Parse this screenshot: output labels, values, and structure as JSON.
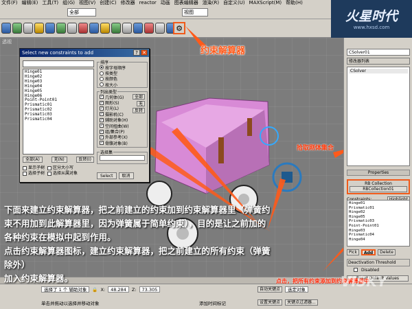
{
  "menubar": [
    "文件(F)",
    "编辑(E)",
    "工具(T)",
    "组(G)",
    "视图(V)",
    "创建(C)",
    "修改器",
    "reactor",
    "动画",
    "图表编辑器",
    "渲染(R)",
    "自定义(U)",
    "MAXScript(M)",
    "帮助(H)"
  ],
  "toolbar": {
    "selection_filter": "全部",
    "coord_system": "视图"
  },
  "logo": {
    "title": "火星时代",
    "url": "www.hxsd.com"
  },
  "viewport": {
    "label": "透视"
  },
  "dialog": {
    "title": "Select new constraints to add",
    "list": [
      "Hinge01",
      "Hinge02",
      "Hinge03",
      "Hinge04",
      "Hinge05",
      "Hinge06",
      "Point-Point01",
      "Prismatic01",
      "Prismatic02",
      "Prismatic03",
      "Prismatic04"
    ],
    "buttons": {
      "all": "全部(A)",
      "none": "无(N)",
      "invert": "反转(I)"
    },
    "options": [
      "显示子树",
      "区分大小写",
      "选择子树",
      "选择从属对象"
    ],
    "sort": {
      "caption": "排序",
      "items": [
        "按字母顺序",
        "按类型",
        "按颜色",
        "按大小"
      ]
    },
    "types": {
      "caption": "列出类型",
      "items": [
        "几何体(G)",
        "图形(S)",
        "灯光(L)",
        "摄影机(C)",
        "辅助对象(H)",
        "空间扭曲(W)",
        "组/集合(P)",
        "外部参考(X)",
        "骨骼对象(B)"
      ],
      "all": "全部",
      "none": "无",
      "invert": "反转"
    },
    "selset": {
      "caption": "选择集"
    },
    "select": "Select",
    "cancel": "取消"
  },
  "right_panel": {
    "name": "CSolver01",
    "modifier_list": "修改器列表",
    "stack_item": "CSolver",
    "rollout": "Properties",
    "rb_collection": "RB Collection",
    "rb_collection_value": "RBCollection01",
    "constraints_label": "Constraints:",
    "highlight": "Highlight",
    "constraints": [
      "Hinge01",
      "Prismatic01",
      "Hinge02",
      "Hinge05",
      "Prismatic03",
      "Point-Point01",
      "Hinge03",
      "Prismatic04",
      "Hinge04"
    ],
    "pick": "Pick",
    "add": "Add",
    "delete": "Delete",
    "deact": "Deactivation Threshold",
    "disabled": "Disabled",
    "reset": "Reset Default Values"
  },
  "status": {
    "selected": "选择了 1 个 辅助对象",
    "x": "48.284",
    "z": "73.305",
    "hint": "单击并拖动以选择并移动对象",
    "add_time": "添加时间标记",
    "keys": "设置关键点",
    "filter": "关键点过滤器...",
    "auto": "自动关键点",
    "sel_obj": "选定对象"
  },
  "annotations": {
    "solver_title": "约束解算器",
    "pick_rb": "拾取刚体集合",
    "add_hint": "点击，把所有约束添加到约束解算器中",
    "body": [
      "下面来建立约束解算器，把之前建立的约束加到约束解算器里（弹簧约",
      "束不用加到此解算器里，因为弹簧属于简单约束），目的是让之前加的",
      "各种约束在模拟中起到作用。",
      "点击约束解算器图标，建立约束解算器，把之前建立的所有约束（弹簧除外）",
      "加入约束解算器。"
    ]
  },
  "watermark": "VISKY"
}
